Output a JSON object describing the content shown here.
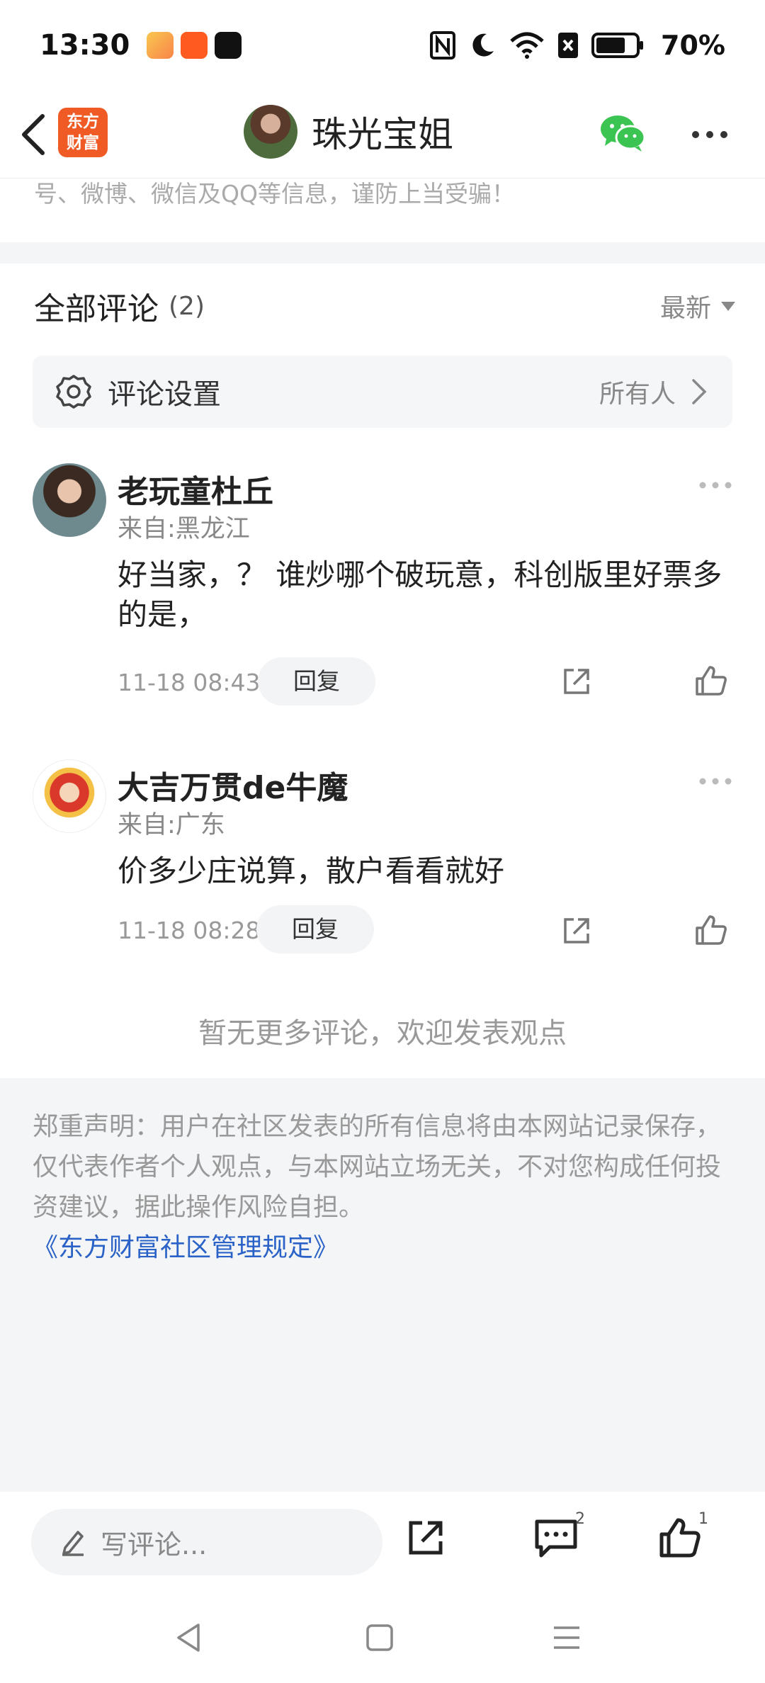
{
  "status_bar": {
    "time": "13:30",
    "battery": "70%",
    "icons": [
      "video-app-icon",
      "app-icon-orange",
      "tiktok-icon",
      "nfc-icon",
      "moon-icon",
      "wifi-icon",
      "sim-off-icon",
      "battery-icon"
    ]
  },
  "nav": {
    "brand_logo": "东方财富",
    "title": "珠光宝姐",
    "icons": [
      "back-icon",
      "wechat-icon",
      "more-icon"
    ]
  },
  "notice": {
    "text": "号、微博、微信及QQ等信息，谨防上当受骗！"
  },
  "comments_section": {
    "title": "全部评论",
    "count": "(2)",
    "sort_label": "最新",
    "settings_label": "评论设置",
    "settings_value": "所有人"
  },
  "comments": [
    {
      "name": "老玩童杜丘",
      "location": "来自:黑龙江",
      "text": "好当家，？ 谁炒哪个破玩意，科创版里好票多的是，",
      "time": "11-18 08:43",
      "reply_label": "回复"
    },
    {
      "name": "大吉万贯de牛魔",
      "location": "来自:广东",
      "text": "价多少庄说算，散户看看就好",
      "time": "11-18 08:28",
      "reply_label": "回复"
    }
  ],
  "no_more": "暂无更多评论，欢迎发表观点",
  "disclaimer": {
    "text": "郑重声明：用户在社区发表的所有信息将由本网站记录保存，仅代表作者个人观点，与本网站立场无关，不对您构成任何投资建议，据此操作风险自担。",
    "link": "《东方财富社区管理规定》"
  },
  "bottom_bar": {
    "input_placeholder": "写评论...",
    "comment_badge": "2",
    "like_badge": "1"
  },
  "colors": {
    "brand": "#f05a24",
    "link": "#2a62c7",
    "wechat": "#3cc452"
  }
}
